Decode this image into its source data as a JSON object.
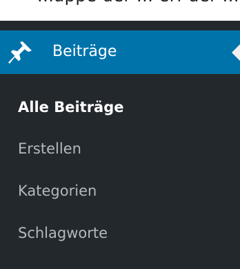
{
  "top_partial_text": "...appe der ... erf der ... ...",
  "menu": {
    "head_label": "Beiträge",
    "head_icon": "pin-icon",
    "colors": {
      "menu_bg": "#23282d",
      "active_bg": "#0073aa",
      "current_text": "#ffffff",
      "item_text": "#b4b9be"
    },
    "items": [
      {
        "label": "Alle Beiträge",
        "current": true
      },
      {
        "label": "Erstellen",
        "current": false
      },
      {
        "label": "Kategorien",
        "current": false
      },
      {
        "label": "Schlagworte",
        "current": false
      }
    ]
  }
}
